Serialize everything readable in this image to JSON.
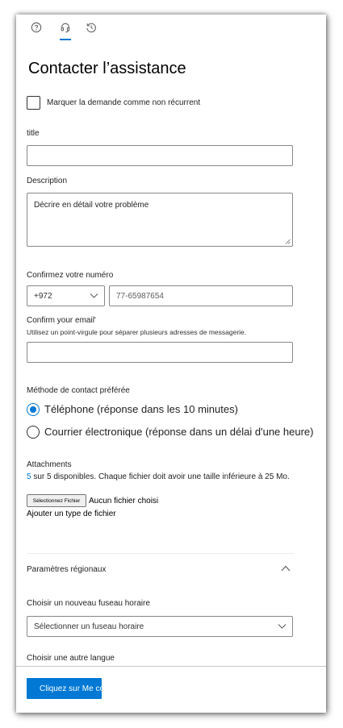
{
  "colors": {
    "accent": "#0078d4",
    "border": "#8a8886",
    "text": "#201f1e"
  },
  "tabs": [
    {
      "icon": "help-circle-icon"
    },
    {
      "icon": "headset-icon",
      "active": true
    },
    {
      "icon": "history-icon"
    }
  ],
  "page_title": "Contacter l’assistance",
  "nonrecurrent_label": "Marquer la demande comme non récurrent",
  "title_field": {
    "label": "title",
    "value": ""
  },
  "description": {
    "label": "Description",
    "value": "Décrire en détail votre problème"
  },
  "phone": {
    "label": "Confirmez votre numéro",
    "country_code": "+972",
    "number": "77-65987654"
  },
  "email": {
    "label": "Confirm your email'",
    "hint": "Utilisez un point-virgule pour séparer plusieurs adresses de messagerie.",
    "value": ""
  },
  "contact_method": {
    "label": "Méthode de contact préférée",
    "options": [
      {
        "label": "Téléphone (réponse dans les 10 minutes)",
        "checked": true
      },
      {
        "label": "Courrier électronique (réponse dans un délai d'une heure)",
        "checked": false
      }
    ]
  },
  "attachments": {
    "label": "Attachments",
    "count_num": "5",
    "count_text": " sur 5 disponibles. Chaque fichier doit avoir une taille inférieure à 25 Mo.",
    "file_button": "Sélectionnez Fichier",
    "no_file": "Aucun fichier choisi",
    "add_type": "Ajouter un type de fichier"
  },
  "regional": {
    "title": "Paramètres régionaux",
    "timezone_label": "Choisir un nouveau fuseau horaire",
    "timezone_value": "Sélectionner un fuseau horaire",
    "language_label": "Choisir une autre langue"
  },
  "submit_label": "Cliquez sur Me contacter"
}
